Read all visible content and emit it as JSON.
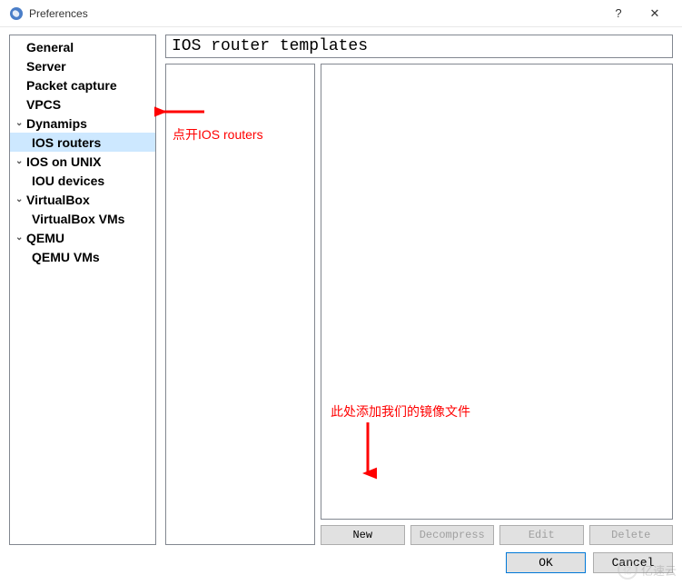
{
  "window": {
    "title": "Preferences",
    "help": "?",
    "close": "✕"
  },
  "sidebar": {
    "items": [
      {
        "label": "General",
        "type": "item",
        "child": false
      },
      {
        "label": "Server",
        "type": "item",
        "child": false
      },
      {
        "label": "Packet capture",
        "type": "item",
        "child": false
      },
      {
        "label": "VPCS",
        "type": "item",
        "child": false
      },
      {
        "label": "Dynamips",
        "type": "group",
        "child": false
      },
      {
        "label": "IOS routers",
        "type": "item",
        "child": true,
        "selected": true
      },
      {
        "label": "IOS on UNIX",
        "type": "group",
        "child": false
      },
      {
        "label": "IOU devices",
        "type": "item",
        "child": true
      },
      {
        "label": "VirtualBox",
        "type": "group",
        "child": false
      },
      {
        "label": "VirtualBox VMs",
        "type": "item",
        "child": true
      },
      {
        "label": "QEMU",
        "type": "group",
        "child": false
      },
      {
        "label": "QEMU VMs",
        "type": "item",
        "child": true
      }
    ]
  },
  "page": {
    "title": "IOS router templates"
  },
  "actions": {
    "new": "New",
    "decompress": "Decompress",
    "edit": "Edit",
    "delete": "Delete"
  },
  "footer": {
    "ok": "OK",
    "cancel": "Cancel"
  },
  "annotations": {
    "open_ios": "点开IOS routers",
    "add_image": "此处添加我们的镜像文件"
  },
  "watermark": "亿速云"
}
